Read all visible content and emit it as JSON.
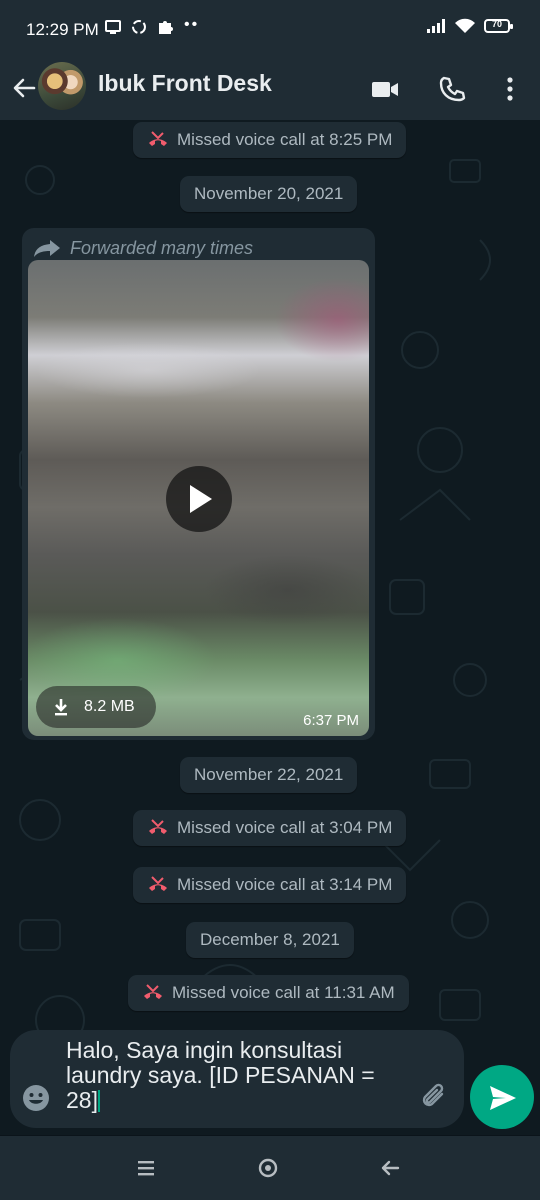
{
  "status_bar": {
    "time": "12:29 PM",
    "dots": "••",
    "battery": "70",
    "icons": [
      "screen-icon",
      "sync-icon",
      "puzzle-icon",
      "signal-icon",
      "wifi-icon",
      "battery-icon"
    ]
  },
  "header": {
    "contact_name": "Ibuk Front Desk",
    "icons": [
      "back-arrow-icon",
      "video-call-icon",
      "phone-icon",
      "more-vert-icon"
    ]
  },
  "messages": {
    "missed_call_1": "Missed voice call at 8:25 PM",
    "date_1": "November 20, 2021",
    "forwarded_label": "Forwarded many times",
    "video_size": "8.2 MB",
    "video_time": "6:37 PM",
    "date_2": "November 22, 2021",
    "missed_call_2": "Missed voice call at 3:04 PM",
    "missed_call_3": "Missed voice call at 3:14 PM",
    "date_3": "December 8, 2021",
    "missed_call_4": "Missed voice call at 11:31 AM"
  },
  "composer": {
    "text": "Halo, Saya ingin konsultasi\nlaundry saya. [ID PESANAN =\n28]"
  },
  "colors": {
    "accent": "#00a884",
    "missed_call": "#f15c6d",
    "bar_bg": "#1f2c34"
  }
}
